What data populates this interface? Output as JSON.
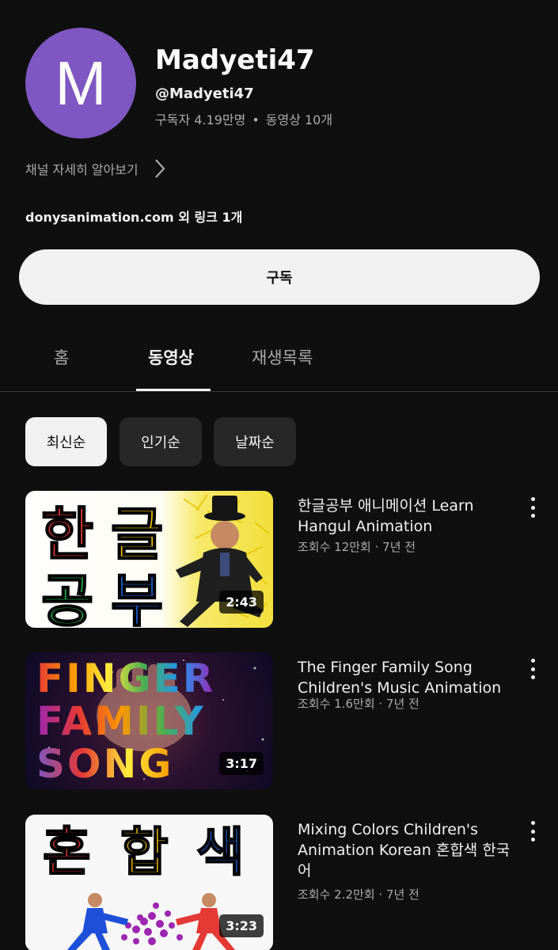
{
  "channel": {
    "avatar_letter": "M",
    "name": "Madyeti47",
    "handle": "@Madyeti47",
    "subscribers": "구독자 4.19만명",
    "videos": "동영상 10개",
    "separator": "•",
    "about_label": "채널 자세히 알아보기",
    "links_label": "donysanimation.com 외 링크 1개",
    "subscribe_label": "구독",
    "avatar_color": "#7e57c2"
  },
  "tabs": [
    {
      "label": "홈"
    },
    {
      "label": "동영상"
    },
    {
      "label": "재생목록"
    }
  ],
  "filters": [
    {
      "label": "최신순"
    },
    {
      "label": "인기순"
    },
    {
      "label": "날짜순"
    }
  ],
  "videos": [
    {
      "title": "한글공부 애니메이션 Learn Hangul Animation",
      "meta": "조회수 12만회 · 7년 전",
      "duration": "2:43",
      "thumb_text": [
        "한",
        "글",
        "공",
        "부"
      ]
    },
    {
      "title": "The Finger Family Song Children's Music Animation",
      "meta": "조회수 1.6만회 · 7년 전",
      "duration": "3:17",
      "thumb_text": [
        "FINGER",
        "FAMILY",
        "SONG"
      ]
    },
    {
      "title": "Mixing Colors Children's Animation Korean 혼합색 한국어",
      "meta": "조회수 2.2만회 · 7년 전",
      "duration": "3:23",
      "thumb_text": [
        "혼",
        "합",
        "색"
      ]
    }
  ]
}
